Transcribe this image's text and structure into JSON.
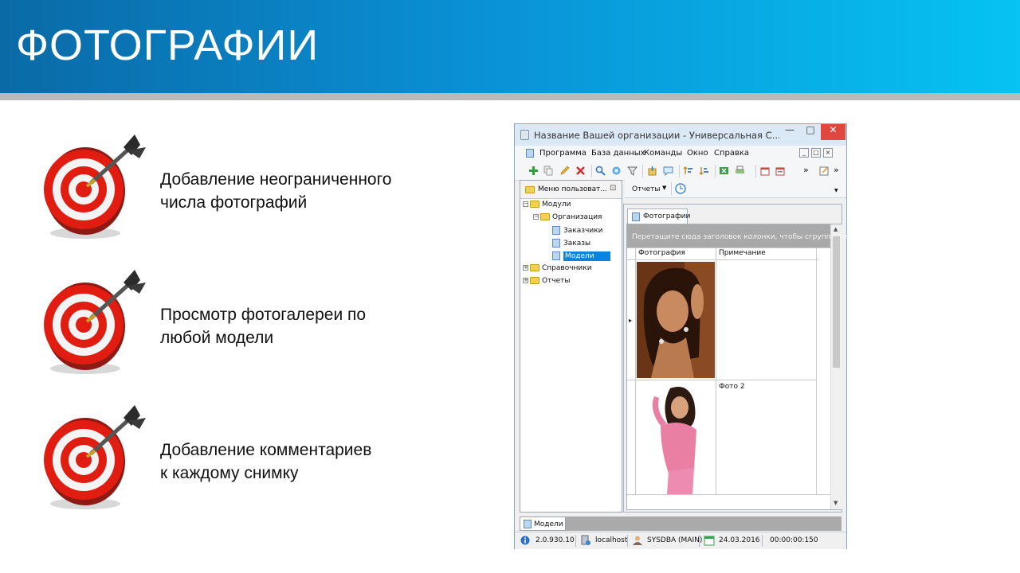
{
  "slide": {
    "title": "ФОТОГРАФИИ",
    "bullets": [
      {
        "line1": "Добавление неограниченного",
        "line2": "числа фотографий",
        "icon": "target-dart-icon"
      },
      {
        "line1": "Просмотр фотогалереи по",
        "line2": "любой модели",
        "icon": "target-dart-icon"
      },
      {
        "line1": "Добавление комментариев",
        "line2": "к каждому снимку",
        "icon": "target-dart-icon"
      }
    ]
  },
  "app": {
    "window_title": "Название Вашей организации - Универсальная С...",
    "menu": [
      "Программа",
      "База данных",
      "Команды",
      "Окно",
      "Справка"
    ],
    "toolbar_overflow": "»",
    "side_panel": {
      "title": "Меню пользоват...",
      "tree": {
        "root": "Модули",
        "org": "Организация",
        "customers": "Заказчики",
        "orders": "Заказы",
        "models": "Модели",
        "references": "Справочники",
        "reports": "Отчеты"
      }
    },
    "reports_menu": "Отчеты",
    "tab_label": "Фотографии",
    "group_panel_text": "Перетащите сюда заголовок колонки, чтобы сгруппиров...",
    "columns": {
      "photo": "Фотография",
      "note": "Примечание"
    },
    "rows": [
      {
        "note": ""
      },
      {
        "note": "Фото 2"
      }
    ],
    "bottom_tab": "Модели",
    "status": {
      "version": "2.0.930.10",
      "host": "localhost",
      "user": "SYSDBA (MAIN)",
      "date": "24.03.2016",
      "time": "00:00:00:150"
    }
  },
  "colors": {
    "banner_start": "#0a6aa6",
    "banner_end": "#06c3f3",
    "strip": "#b9b9b9",
    "close_button": "#e0473f",
    "selection": "#0a84e0"
  }
}
